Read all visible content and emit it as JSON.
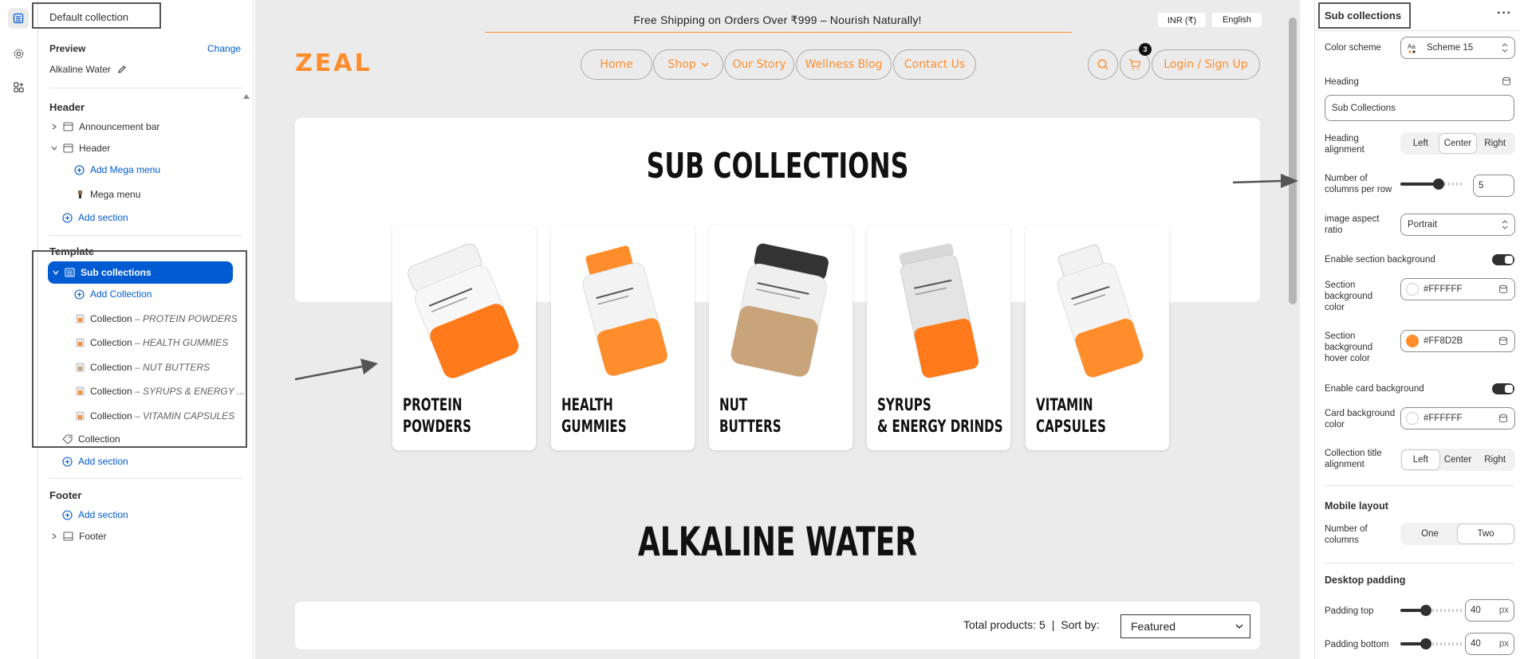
{
  "left_panel": {
    "title": "Default collection",
    "preview_label": "Preview",
    "change_link": "Change",
    "preview_value": "Alkaline Water",
    "header_section": "Header",
    "header_items": [
      {
        "label": "Announcement bar"
      },
      {
        "label": "Header"
      }
    ],
    "add_mega_menu": "Add Mega menu",
    "mega_menu": "Mega menu",
    "add_section": "Add section",
    "template_section": "Template",
    "selected_item": "Sub collections",
    "add_collection": "Add Collection",
    "collections": [
      {
        "prefix": "Collection",
        "name": "– PROTEIN POWDERS"
      },
      {
        "prefix": "Collection",
        "name": "– HEALTH GUMMIES"
      },
      {
        "prefix": "Collection",
        "name": "– NUT BUTTERS"
      },
      {
        "prefix": "Collection",
        "name": "– SYRUPS & ENERGY ..."
      },
      {
        "prefix": "Collection",
        "name": "– VITAMIN CAPSULES"
      }
    ],
    "collection_item": "Collection",
    "footer_section": "Footer",
    "footer_item": "Footer"
  },
  "storefront": {
    "announcement": "Free Shipping on Orders Over ₹999 – Nourish Naturally!",
    "currency": "INR (₹)",
    "language": "English",
    "logo": "ZEAL",
    "nav": [
      "Home",
      "Shop",
      "Our Story",
      "Wellness Blog",
      "Contact Us"
    ],
    "cart_count": "3",
    "login": "Login / Sign Up",
    "section_heading": "SUB COLLECTIONS",
    "cards": [
      {
        "line1": "PROTEIN",
        "line2": "POWDERS",
        "label_color": "#ff7a1a",
        "lid": "#f2f2f2"
      },
      {
        "line1": "HEALTH",
        "line2": "GUMMIES",
        "label_color": "#ff8d2b",
        "lid": "#ff8d2b"
      },
      {
        "line1": "NUT",
        "line2": "BUTTERS",
        "label_color": "#c9a47a",
        "lid": "#333333"
      },
      {
        "line1": "SYRUPS",
        "line2": "& ENERGY DRINDS",
        "label_color": "#ff7a1a",
        "lid": "#d8d8d8"
      },
      {
        "line1": "VITAMIN",
        "line2": "CAPSULES",
        "label_color": "#ff8d2b",
        "lid": "#f2f2f2"
      }
    ],
    "collection_heading": "ALKALINE WATER",
    "total_products": "Total products: 5",
    "sort_label": "Sort by:",
    "sort_value": "Featured"
  },
  "right_panel": {
    "title": "Sub collections",
    "color_scheme_label": "Color scheme",
    "color_scheme_value": "Scheme 15",
    "heading_label": "Heading",
    "heading_value": "Sub Collections",
    "heading_alignment_label": "Heading alignment",
    "heading_alignment_options": [
      "Left",
      "Center",
      "Right"
    ],
    "heading_alignment_selected": "Center",
    "columns_label": "Number of columns per row",
    "columns_value": "5",
    "columns_fraction": 0.6,
    "aspect_label": "image aspect ratio",
    "aspect_value": "Portrait",
    "enable_bg_label": "Enable section background",
    "enable_bg_on": true,
    "section_bg_label": "Section background color",
    "section_bg_value": "#FFFFFF",
    "section_hover_label": "Section background hover color",
    "section_hover_value": "#FF8D2B",
    "enable_card_bg_label": "Enable card background",
    "enable_card_bg_on": true,
    "card_bg_label": "Card background color",
    "card_bg_value": "#FFFFFF",
    "title_alignment_label": "Collection title alignment",
    "title_alignment_options": [
      "Left",
      "Center",
      "Right"
    ],
    "title_alignment_selected": "Left",
    "mobile_layout_title": "Mobile layout",
    "mobile_columns_label": "Number of columns",
    "mobile_columns_options": [
      "One",
      "Two"
    ],
    "mobile_columns_selected": "Two",
    "desktop_padding_title": "Desktop padding",
    "padding_top_label": "Padding top",
    "padding_top_value": "40",
    "padding_bottom_label": "Padding bottom",
    "padding_bottom_value": "40",
    "px_unit": "px",
    "padding_fraction": 0.4
  },
  "colors": {
    "accent": "#ff8d2b",
    "selection": "#005bd3",
    "link": "#005bd3"
  }
}
